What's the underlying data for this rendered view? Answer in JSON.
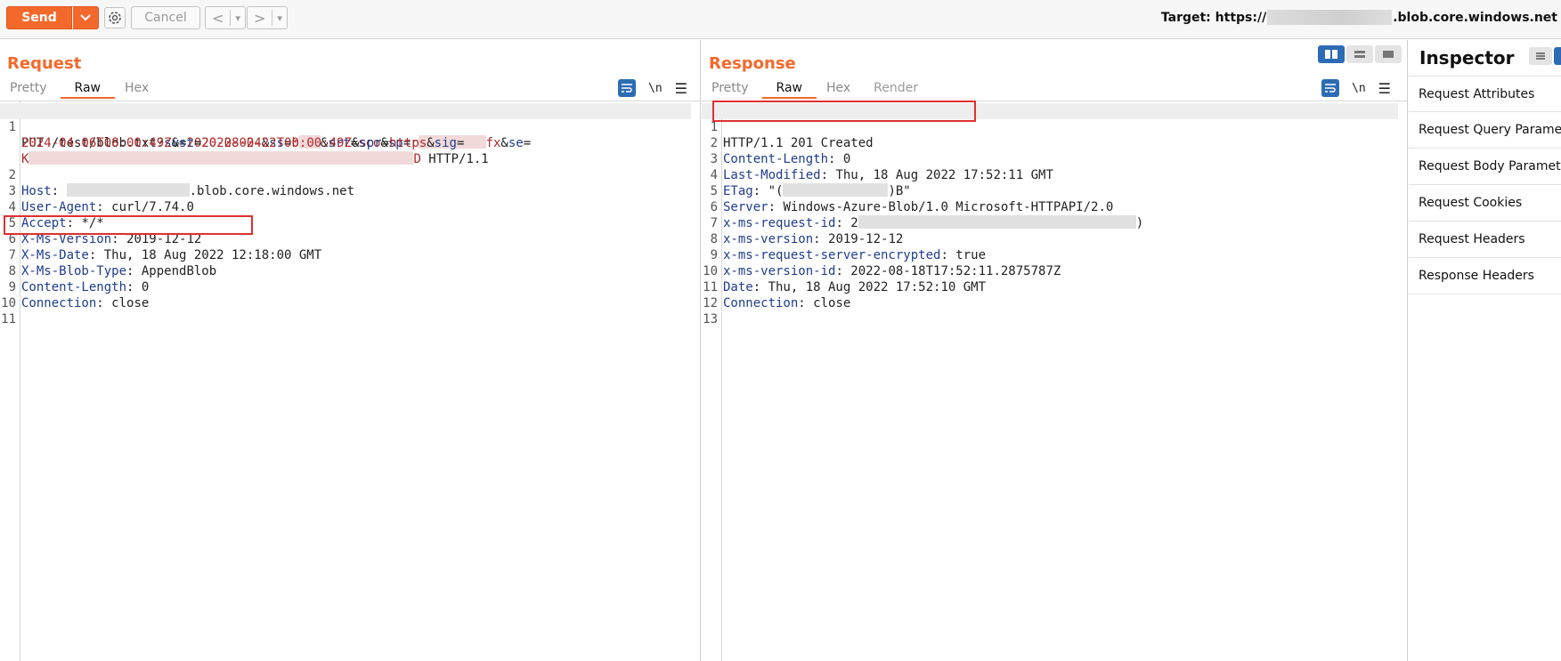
{
  "toolbar": {
    "send_label": "Send",
    "cancel_label": "Cancel",
    "back_glyph": "<",
    "forward_glyph": ">",
    "dropdown_glyph": "▾",
    "target_prefix": "Target: https://",
    "target_suffix": ".blob.core.windows.net"
  },
  "request": {
    "title": "Request",
    "tabs": [
      "Pretty",
      "Raw",
      "Hex"
    ],
    "active_tab": "Raw",
    "newline_toggle": "\\n",
    "lines": {
      "l1_a": "PUT /test/",
      "l1_b": "blob.txt?",
      "sv_key": "sv",
      "sv_val": "2020-08-04",
      "ss_key": "ss",
      "ss_val_start": "b",
      "srt_key": "srt",
      "srt_val": "sco",
      "sp_key": "sp",
      "sp_val_start": "r",
      "sp_val_end": "fx",
      "se_key": "se",
      "se_val": "2024-04-06T08:00:49Z",
      "st_key": "st",
      "st_val": "2022-02-22T00:00:49Z",
      "spr_key": "spr",
      "spr_val": "https",
      "sig_key": "sig",
      "sig_val_start": "K",
      "sig_val_end": "D",
      "l1_end": " HTTP/1.1",
      "host_key": "Host",
      "host_val": ".blob.core.windows.net",
      "ua_key": "User-Agent",
      "ua_val": "curl/7.74.0",
      "accept_key": "Accept",
      "accept_val": "*/*",
      "ver_key": "X-Ms-Version",
      "ver_val": "2019-12-12",
      "date_key": "X-Ms-Date",
      "date_val": "Thu, 18 Aug 2022 12:18:00 GMT",
      "blob_key": "X-Ms-Blob-Type",
      "blob_val": "AppendBlob",
      "cl_key": "Content-Length",
      "cl_val": "0",
      "conn_key": "Connection",
      "conn_val": "close"
    },
    "line_numbers": [
      "1",
      "2",
      "3",
      "4",
      "5",
      "6",
      "7",
      "8",
      "9",
      "10",
      "11"
    ]
  },
  "response": {
    "title": "Response",
    "tabs": [
      "Pretty",
      "Raw",
      "Hex",
      "Render"
    ],
    "active_tab": "Raw",
    "newline_toggle": "\\n",
    "lines": {
      "status": "HTTP/1.1 201 Created",
      "cl_key": "Content-Length",
      "cl_val": "0",
      "lm_key": "Last-Modified",
      "lm_val": "Thu, 18 Aug 2022 17:52:11 GMT",
      "etag_key": "ETag",
      "etag_start": "\"(",
      "etag_end": ")B\"",
      "server_key": "Server",
      "server_val": "Windows-Azure-Blob/1.0 Microsoft-HTTPAPI/2.0",
      "reqid_key": "x-ms-request-id",
      "reqid_start": "2",
      "reqid_end": ")",
      "ver_key": "x-ms-version",
      "ver_val": "2019-12-12",
      "enc_key": "x-ms-request-server-encrypted",
      "enc_val": "true",
      "verid_key": "x-ms-version-id",
      "verid_val": "2022-08-18T17:52:11.2875787Z",
      "date_key": "Date",
      "date_val": "Thu, 18 Aug 2022 17:52:10 GMT",
      "conn_key": "Connection",
      "conn_val": "close"
    },
    "line_numbers": [
      "1",
      "2",
      "3",
      "4",
      "5",
      "6",
      "7",
      "8",
      "9",
      "10",
      "11",
      "12",
      "13"
    ]
  },
  "inspector": {
    "title": "Inspector",
    "items": [
      "Request Attributes",
      "Request Query Parameters",
      "Request Body Parameters",
      "Request Cookies",
      "Request Headers",
      "Response Headers"
    ]
  },
  "colors": {
    "accent": "#f3692c",
    "key": "#1f3d8c",
    "value": "#b02a2a",
    "highlight_box": "#e03030",
    "toggle_active": "#2d6cb5"
  }
}
